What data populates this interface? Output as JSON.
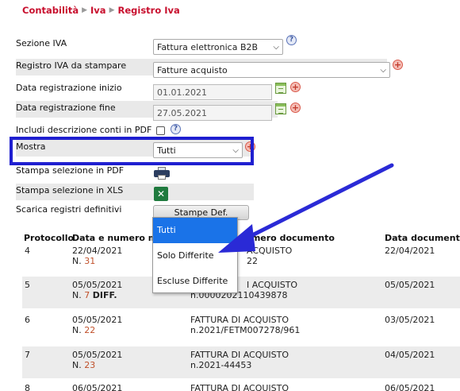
{
  "breadcrumb": {
    "items": [
      "Contabilità",
      "Iva",
      "Registro Iva"
    ]
  },
  "form": {
    "sezione_iva": {
      "label": "Sezione IVA",
      "value": "Fattura elettronica B2B"
    },
    "registro": {
      "label": "Registro IVA da stampare",
      "value": "Fatture acquisto"
    },
    "data_inizio": {
      "label": "Data registrazione inizio",
      "value": "01.01.2021"
    },
    "data_fine": {
      "label": "Data registrazione fine",
      "value": "27.05.2021"
    },
    "includi_descrizione": {
      "label": "Includi descrizione conti in PDF",
      "checked": false
    },
    "mostra": {
      "label": "Mostra",
      "value": "Tutti"
    },
    "stampa_pdf": {
      "label": "Stampa selezione in PDF"
    },
    "stampa_xls": {
      "label": "Stampa selezione in XLS"
    },
    "scarica": {
      "label": "Scarica registri definitivi",
      "button": "Stampe Def."
    }
  },
  "dropdown": {
    "options": [
      "Tutti",
      "Solo Differite",
      "Escluse Differite"
    ],
    "selected": "Tutti"
  },
  "table": {
    "columns": [
      "Protocollo",
      "Data e numero mo",
      "umero documento",
      "Data documento"
    ],
    "rows": [
      {
        "protocollo": "4",
        "data": "22/04/2021",
        "numero_prefix": "N.",
        "numero": "31",
        "diff": "",
        "tipo": "ACQUISTO",
        "documento": "22",
        "data_documento": "22/04/2021"
      },
      {
        "protocollo": "5",
        "data": "05/05/2021",
        "numero_prefix": "N.",
        "numero": "7",
        "diff": "DIFF.",
        "tipo": "I ACQUISTO",
        "documento": "n.0000202110439878",
        "data_documento": "05/05/2021"
      },
      {
        "protocollo": "6",
        "data": "05/05/2021",
        "numero_prefix": "N.",
        "numero": "22",
        "diff": "",
        "tipo": "FATTURA DI ACQUISTO",
        "documento": "n.2021/FETM007278/961",
        "data_documento": "03/05/2021"
      },
      {
        "protocollo": "7",
        "data": "05/05/2021",
        "numero_prefix": "N.",
        "numero": "23",
        "diff": "",
        "tipo": "FATTURA DI ACQUISTO",
        "documento": "n.2021-44453",
        "data_documento": "04/05/2021"
      },
      {
        "protocollo": "8",
        "data": "06/05/2021",
        "numero_prefix": "",
        "numero": "",
        "diff": "",
        "tipo": "FATTURA DI ACQUISTO",
        "documento": "",
        "data_documento": "06/05/2021"
      }
    ]
  },
  "colors": {
    "accent_red": "#c8102e",
    "highlight_blue": "#1f1fd0",
    "select_blue": "#1a73e8",
    "link_orange": "#c0502a"
  },
  "icons": [
    "help-icon",
    "plus-icon",
    "calendar-icon",
    "printer-icon",
    "excel-icon",
    "chevron-down-icon",
    "arrow-annotation"
  ]
}
